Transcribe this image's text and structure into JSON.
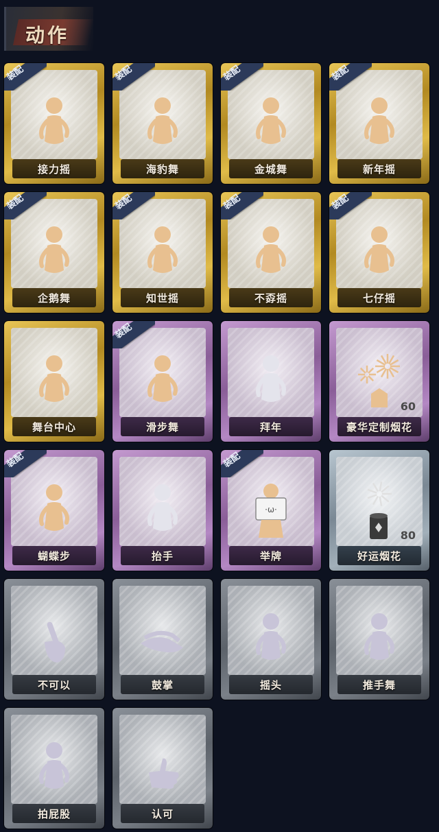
{
  "header": {
    "title": "动作"
  },
  "badge_text": "装配",
  "cards": [
    {
      "label": "接力摇",
      "tier": "gold",
      "equipped": true,
      "icon": "dancer-icon"
    },
    {
      "label": "海豹舞",
      "tier": "gold",
      "equipped": true,
      "icon": "dancer-icon"
    },
    {
      "label": "金城舞",
      "tier": "gold",
      "equipped": true,
      "icon": "dancer-icon"
    },
    {
      "label": "新年摇",
      "tier": "gold",
      "equipped": true,
      "icon": "dancer-icon"
    },
    {
      "label": "企鹅舞",
      "tier": "gold",
      "equipped": true,
      "icon": "dancer-icon"
    },
    {
      "label": "知世摇",
      "tier": "gold",
      "equipped": true,
      "icon": "dancer-icon"
    },
    {
      "label": "不孬摇",
      "tier": "gold",
      "equipped": true,
      "icon": "dancer-icon"
    },
    {
      "label": "七仔摇",
      "tier": "gold",
      "equipped": true,
      "icon": "dancer-icon"
    },
    {
      "label": "舞台中心",
      "tier": "gold",
      "equipped": false,
      "icon": "dancer-icon"
    },
    {
      "label": "滑步舞",
      "tier": "purple",
      "equipped": true,
      "icon": "dancer-icon"
    },
    {
      "label": "拜年",
      "tier": "purple",
      "equipped": false,
      "icon": "bow-icon"
    },
    {
      "label": "豪华定制烟花",
      "tier": "purple",
      "equipped": false,
      "icon": "fireworks-icon",
      "count": "60"
    },
    {
      "label": "蝴蝶步",
      "tier": "purple",
      "equipped": true,
      "icon": "dancer-icon"
    },
    {
      "label": "抬手",
      "tier": "purple",
      "equipped": false,
      "icon": "raise-hand-icon"
    },
    {
      "label": "举牌",
      "tier": "purple",
      "equipped": true,
      "icon": "sign-icon"
    },
    {
      "label": "好运烟花",
      "tier": "silver",
      "equipped": false,
      "icon": "firecracker-icon",
      "count": "80"
    },
    {
      "label": "不可以",
      "tier": "grey",
      "equipped": false,
      "icon": "finger-wag-icon"
    },
    {
      "label": "鼓掌",
      "tier": "grey",
      "equipped": false,
      "icon": "clap-icon"
    },
    {
      "label": "摇头",
      "tier": "grey",
      "equipped": false,
      "icon": "shake-head-icon"
    },
    {
      "label": "推手舞",
      "tier": "grey",
      "equipped": false,
      "icon": "dancer-icon"
    },
    {
      "label": "拍屁股",
      "tier": "grey",
      "equipped": false,
      "icon": "slap-icon"
    },
    {
      "label": "认可",
      "tier": "grey",
      "equipped": false,
      "icon": "thumbs-up-icon"
    }
  ]
}
